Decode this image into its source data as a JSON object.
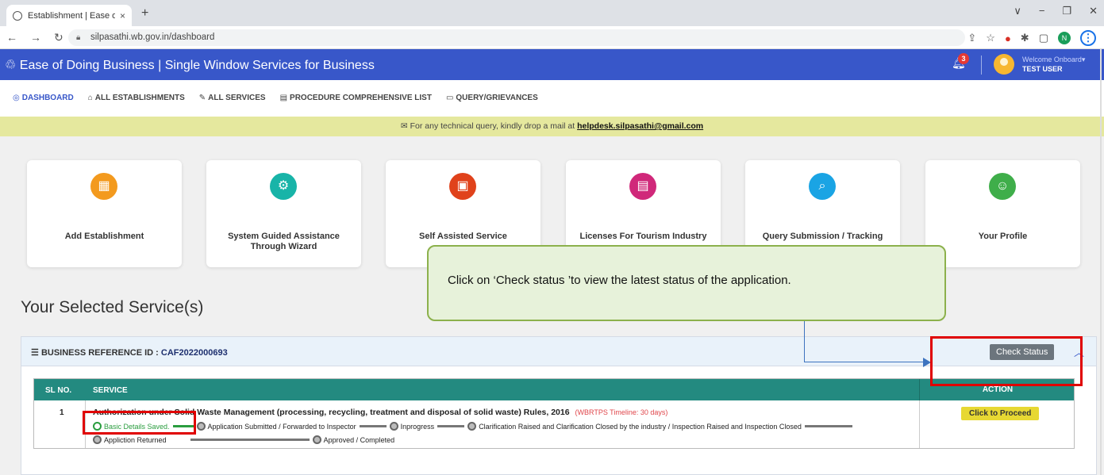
{
  "browser": {
    "tab_title": "Establishment | Ease of doing bu",
    "tab_close": "×",
    "new_tab": "+",
    "url": "silpasathi.wb.gov.in/dashboard",
    "window_controls": [
      "∨",
      "−",
      "❐",
      "✕"
    ],
    "profile_initial": "N"
  },
  "header": {
    "title": "Ease of Doing Business | Single Window Services for Business",
    "notification_count": "3",
    "welcome": "Welcome Onboard▾",
    "user": "TEST USER"
  },
  "menu": {
    "items": [
      {
        "icon": "◎",
        "label": "DASHBOARD"
      },
      {
        "icon": "⌂",
        "label": "ALL ESTABLISHMENTS"
      },
      {
        "icon": "✎",
        "label": "ALL SERVICES"
      },
      {
        "icon": "▤",
        "label": "PROCEDURE COMPREHENSIVE LIST"
      },
      {
        "icon": "▭",
        "label": "QUERY/GRIEVANCES"
      }
    ]
  },
  "info": {
    "prefix": "For any technical query, kindly drop a mail at ",
    "email": "helpdesk.silpasathi@gmail.com"
  },
  "cards": [
    {
      "label": "Add Establishment",
      "icon": "▦",
      "color": "#f39a1e"
    },
    {
      "label": "System Guided Assistance Through Wizard",
      "icon": "⚙",
      "color": "#18b4a8"
    },
    {
      "label": "Self Assisted Service",
      "icon": "▣",
      "color": "#e0421b"
    },
    {
      "label": "Licenses For Tourism Industry",
      "icon": "▤",
      "color": "#d0287a"
    },
    {
      "label": "Query Submission / Tracking",
      "icon": "⌕",
      "color": "#1aa4e4"
    },
    {
      "label": "Your Profile",
      "icon": "☺",
      "color": "#3fae4a"
    }
  ],
  "section_title": "Your Selected Service(s)",
  "callout": {
    "text": "Click on ‘Check status ’to view the latest status of the application."
  },
  "panel": {
    "ref_label": "BUSINESS REFERENCE ID : ",
    "ref_id": "CAF2022000693",
    "check_status": "Check Status",
    "columns": [
      "SL NO.",
      "SERVICE",
      "ACTION"
    ],
    "rows": [
      {
        "sl": "1",
        "service": "Authorization under Solid Waste Management (processing, recycling, treatment and disposal of solid waste) Rules, 2016",
        "timeline": "(WBRTPS Timeline: 30 days)",
        "steps": [
          "Basic Details Saved.",
          "Application Submitted / Forwarded to Inspector",
          "Inprogress",
          "Clarification Raised and Clarification Closed by the industry / Inspection Raised and Inspection Closed",
          "Appliction Returned",
          "Approved / Completed"
        ],
        "completed_steps": 1,
        "action": "Click to Proceed"
      }
    ]
  }
}
